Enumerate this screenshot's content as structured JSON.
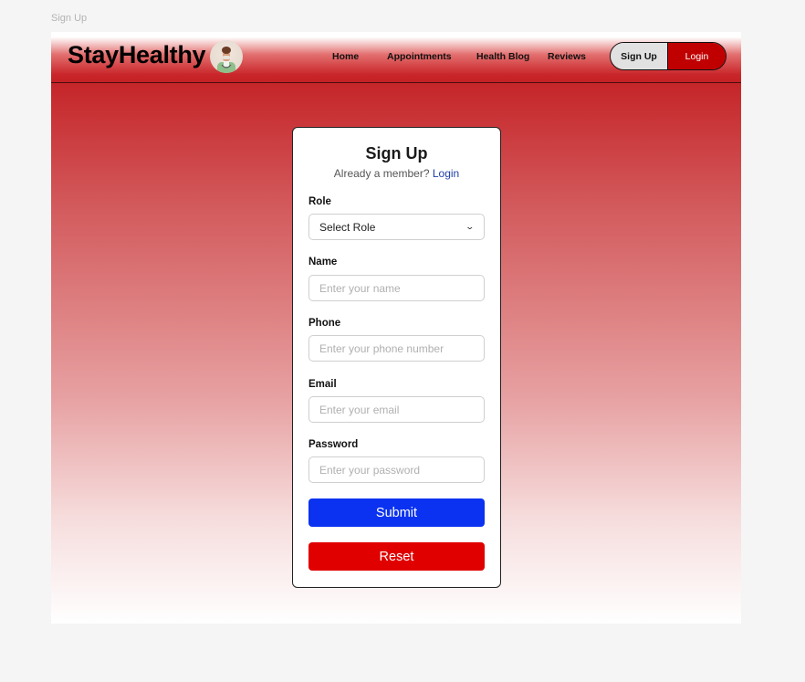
{
  "frame_label": "Sign Up",
  "navbar": {
    "brand": "StayHealthy",
    "links": [
      "Home",
      "Appointments",
      "Health Blog",
      "Reviews"
    ],
    "signup_label": "Sign Up",
    "login_label": "Login"
  },
  "form": {
    "title": "Sign Up",
    "member_text": "Already a member?",
    "login_link": "Login",
    "role": {
      "label": "Role",
      "value": "Select Role"
    },
    "name": {
      "label": "Name",
      "placeholder": "Enter your name"
    },
    "phone": {
      "label": "Phone",
      "placeholder": "Enter your phone number"
    },
    "email": {
      "label": "Email",
      "placeholder": "Enter your email"
    },
    "password": {
      "label": "Password",
      "placeholder": "Enter your password"
    },
    "submit_label": "Submit",
    "reset_label": "Reset"
  },
  "colors": {
    "brand_red": "#c42125",
    "submit_blue": "#0a32f0",
    "reset_red": "#e00000",
    "link_blue": "#1f3fa8"
  },
  "icons": {
    "role_select": "chevron-down-icon",
    "brand": "doctor-avatar-icon"
  }
}
